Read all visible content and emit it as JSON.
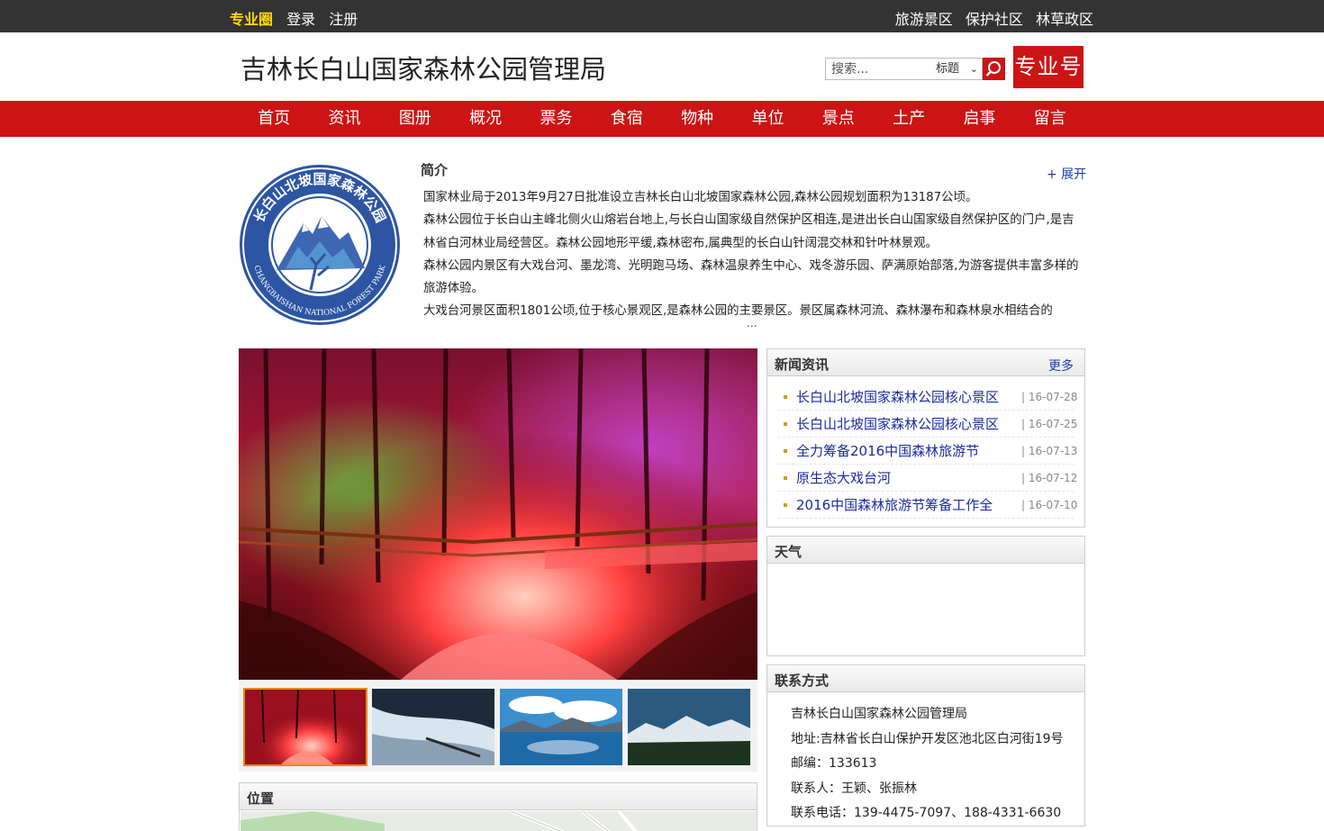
{
  "topbar": {
    "brand": "专业圈",
    "login": "登录",
    "register": "注册",
    "links": [
      "旅游景区",
      "保护社区",
      "林草政区"
    ]
  },
  "header": {
    "site_title": "吉林长白山国家森林公园管理局",
    "search_placeholder": "搜索...",
    "search_scope": "标题",
    "pro_badge": "专业号"
  },
  "nav": [
    "首页",
    "资讯",
    "图册",
    "概况",
    "票务",
    "食宿",
    "物种",
    "单位",
    "景点",
    "土产",
    "启事",
    "留言"
  ],
  "intro": {
    "title": "简介",
    "expand": "+ 展开",
    "paragraphs": [
      "国家林业局于2013年9月27日批准设立吉林长白山北坡国家森林公园,森林公园规划面积为13187公顷。",
      "森林公园位于长白山主峰北侧火山熔岩台地上,与长白山国家级自然保护区相连,是进出长白山国家级自然保护区的门户,是吉林省白河林业局经营区。森林公园地形平缓,森林密布,属典型的长白山针阔混交林和针叶林景观。",
      "森林公园内景区有大戏台河、墨龙湾、光明跑马场、森林温泉养生中心、戏冬游乐园、萨满原始部落,为游客提供丰富多样的旅游体验。",
      "大戏台河景区面积1801公顷,位于核心景观区,是森林公园的主要景区。景区属森林河流、森林瀑布和森林泉水相结合的"
    ],
    "ellipsis": "...",
    "logo_text_cn": "长白山北坡国家森林公园",
    "logo_text_en": "CHANGBAISHAN NATIONAL FOREST PARK"
  },
  "news": {
    "title": "新闻资讯",
    "more": "更多",
    "items": [
      {
        "title": "长白山北坡国家森林公园核心景区",
        "date": "| 16-07-28"
      },
      {
        "title": "长白山北坡国家森林公园核心景区",
        "date": "| 16-07-25"
      },
      {
        "title": "全力筹备2016中国森林旅游节",
        "date": "| 16-07-13"
      },
      {
        "title": "原生态大戏台河",
        "date": "| 16-07-12"
      },
      {
        "title": "2016中国森林旅游节筹备工作全",
        "date": "| 16-07-10"
      }
    ]
  },
  "weather": {
    "title": "天气"
  },
  "contact": {
    "title": "联系方式",
    "lines": [
      "吉林长白山国家森林公园管理局",
      "地址:吉林省长白山保护开发区池北区白河街19号",
      "邮编：133613",
      "联系人：王颖、张振林",
      "联系电话：139-4475-7097、188-4331-6630"
    ]
  },
  "location": {
    "title": "位置"
  },
  "colors": {
    "brand_red": "#cc1414",
    "topbar": "#333333",
    "link_blue": "#1a2aa0",
    "highlight_yellow": "#ffd800"
  }
}
